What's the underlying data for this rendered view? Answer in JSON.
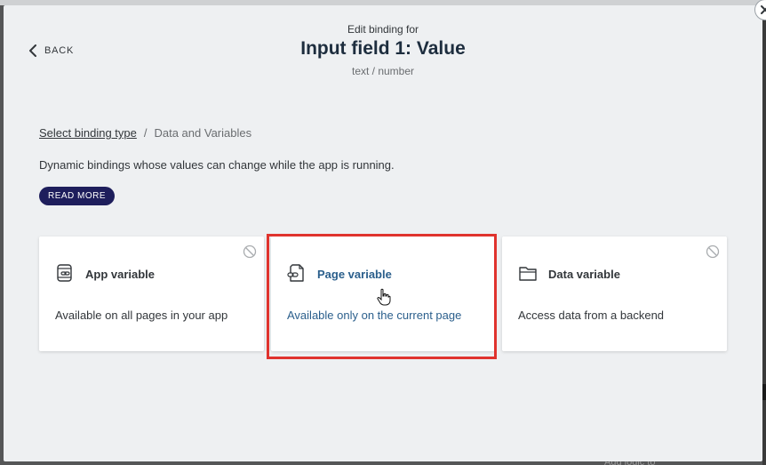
{
  "modal": {
    "eyebrow": "Edit binding for",
    "title": "Input field 1: Value",
    "subtitle": "text / number",
    "back_label": "BACK"
  },
  "breadcrumb": {
    "link": "Select binding type",
    "separator": "/",
    "current": "Data and Variables"
  },
  "description": "Dynamic bindings whose values can change while the app is running.",
  "read_more_label": "READ MORE",
  "cards": [
    {
      "title": "App variable",
      "description": "Available on all pages in your app",
      "icon": "app-variable-icon",
      "disabled": true
    },
    {
      "title": "Page variable",
      "description": "Available only on the current page",
      "icon": "page-variable-icon",
      "disabled": false,
      "hovered": true
    },
    {
      "title": "Data variable",
      "description": "Access data from a backend",
      "icon": "data-variable-icon",
      "disabled": true
    }
  ],
  "background": {
    "footer_text": "Add logic to"
  },
  "colors": {
    "accent": "#1e1e5c",
    "highlight": "#e0332e",
    "link_active": "#2b5f8c"
  }
}
